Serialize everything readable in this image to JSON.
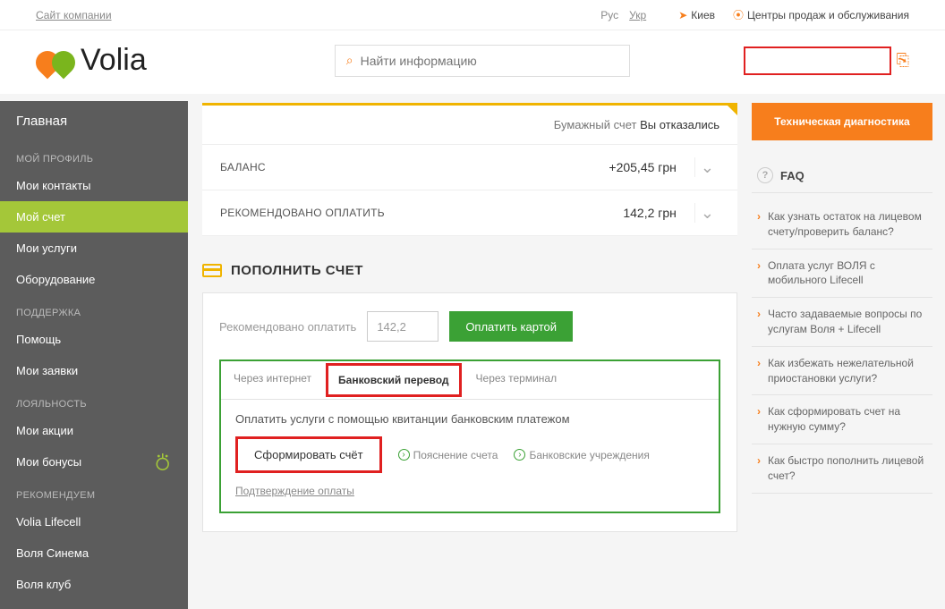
{
  "topbar": {
    "site_link": "Сайт компании",
    "lang_ru": "Рус",
    "lang_uk": "Укр",
    "city": "Киев",
    "centers": "Центры продаж и обслуживания"
  },
  "header": {
    "logo_text": "Volia",
    "search_placeholder": "Найти информацию"
  },
  "sidebar": {
    "main": "Главная",
    "sections": [
      {
        "label": "МОЙ ПРОФИЛЬ",
        "items": [
          "Мои контакты",
          "Мой счет",
          "Мои услуги",
          "Оборудование"
        ]
      },
      {
        "label": "ПОДДЕРЖКА",
        "items": [
          "Помощь",
          "Мои заявки"
        ]
      },
      {
        "label": "ЛОЯЛЬНОСТЬ",
        "items": [
          "Мои акции",
          "Мои бонусы"
        ]
      },
      {
        "label": "РЕКОМЕНДУЕМ",
        "items": [
          "Volia Lifecell",
          "Воля Синема",
          "Воля клуб"
        ]
      }
    ],
    "active": "Мой счет"
  },
  "account": {
    "paper_label": "Бумажный счет",
    "paper_status": "Вы отказались",
    "balance_label": "БАЛАНС",
    "balance_value": "+205,45 грн",
    "recommend_label": "РЕКОМЕНДОВАНО ОПЛАТИТЬ",
    "recommend_value": "142,2 грн"
  },
  "topup": {
    "title": "ПОПОЛНИТЬ СЧЕТ",
    "recommend_label": "Рекомендовано оплатить",
    "amount": "142,2",
    "pay_card_btn": "Оплатить картой",
    "tabs": {
      "internet": "Через интернет",
      "bank": "Банковский перевод",
      "terminal": "Через терминал"
    },
    "bank_desc": "Оплатить услуги с помощью квитанции банковским платежом",
    "form_btn": "Сформировать счёт",
    "explain": "Пояснение счета",
    "banks": "Банковские учреждения",
    "confirm": "Подтверждение оплаты"
  },
  "right": {
    "diag_btn": "Техническая диагностика",
    "faq_title": "FAQ",
    "faq_items": [
      "Как узнать остаток на лицевом счету/проверить баланс?",
      "Оплата услуг ВОЛЯ с мобильного Lifecell",
      "Часто задаваемые вопросы по услугам Воля + Lifecell",
      "Как избежать нежелательной приостановки услуги?",
      "Как сформировать счет на нужную сумму?",
      "Как быстро пополнить лицевой счет?"
    ]
  }
}
